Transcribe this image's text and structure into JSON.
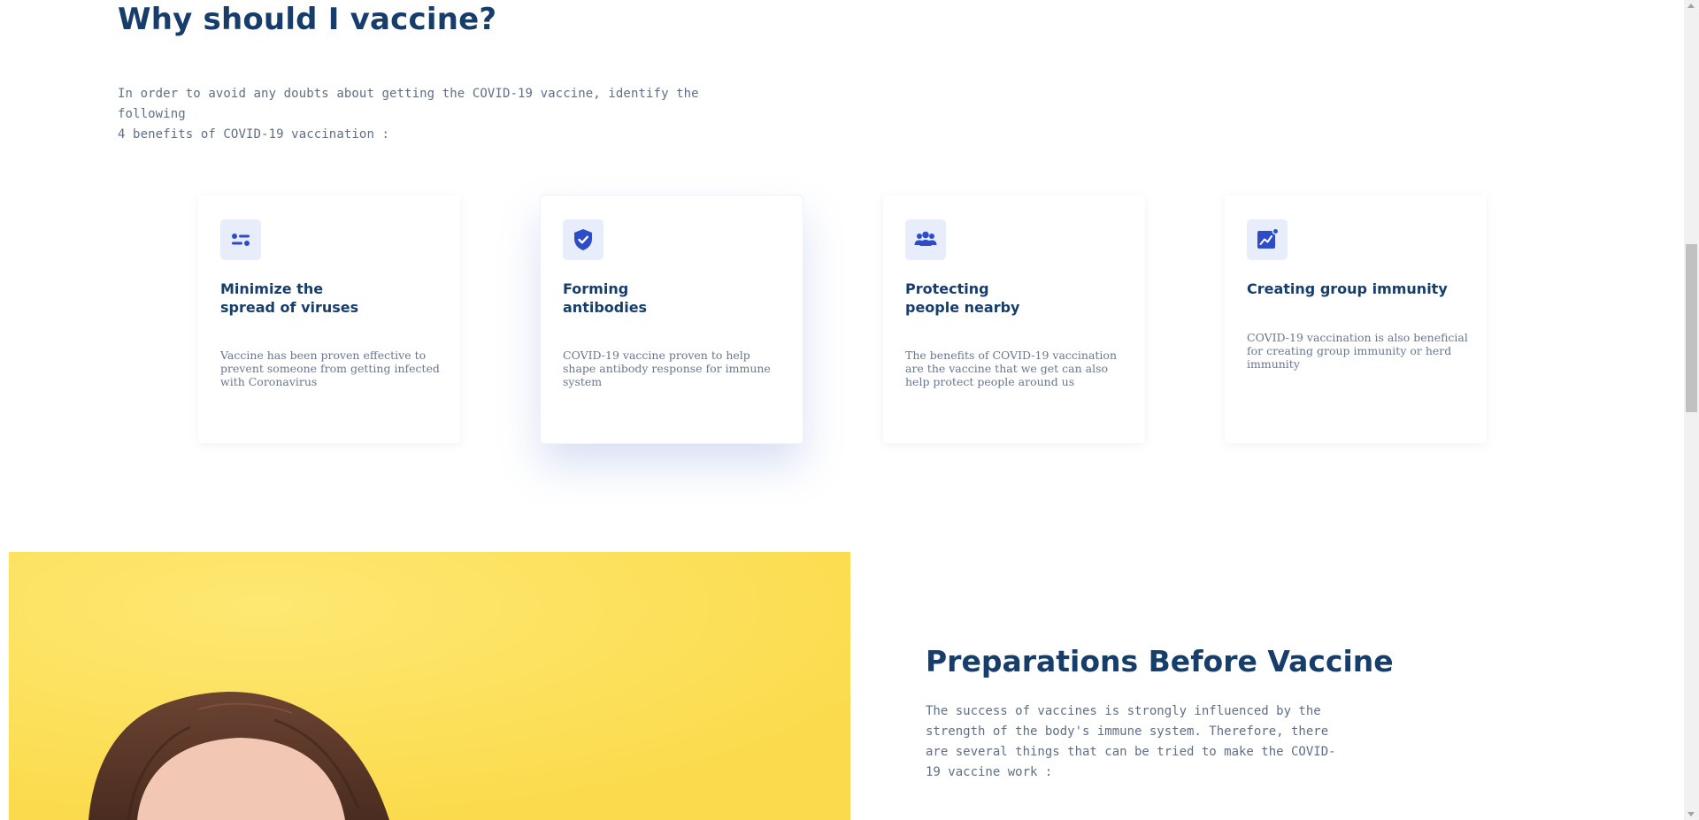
{
  "why_section": {
    "title": "Why should I vaccine?",
    "intro_line1": "In order to avoid any doubts about getting the COVID-19 vaccine, identify the following",
    "intro_line2": "4 benefits of COVID-19 vaccination :"
  },
  "cards": [
    {
      "icon": "sliders-icon",
      "title_line1": "Minimize the",
      "title_line2": "spread of viruses",
      "text": "Vaccine has been proven effective to prevent someone from getting infected with Coronavirus"
    },
    {
      "icon": "shield-check-icon",
      "title_line1": "Forming",
      "title_line2": "antibodies",
      "text": "COVID-19 vaccine proven to help shape antibody response for immune system"
    },
    {
      "icon": "people-group-icon",
      "title_line1": "Protecting",
      "title_line2": "people nearby",
      "text": "The benefits of COVID-19 vaccination are the vaccine that we get can also help protect people around us"
    },
    {
      "icon": "chart-growth-icon",
      "title_line1": "Creating group immunity",
      "title_line2": "",
      "text": "COVID-19 vaccination is also beneficial for creating group immunity or herd immunity"
    }
  ],
  "prep_section": {
    "title": "Preparations Before Vaccine",
    "text": "The success of vaccines is strongly influenced by the strength of the body's immune system. Therefore, there are several things that can be tried to make the COVID-19 vaccine work :"
  },
  "colors": {
    "heading": "#173d6b",
    "body_text": "#5f6f86",
    "accent_blue": "#2e4cc7",
    "icon_bg": "#e7edfb",
    "photo_bg": "#fde159"
  }
}
